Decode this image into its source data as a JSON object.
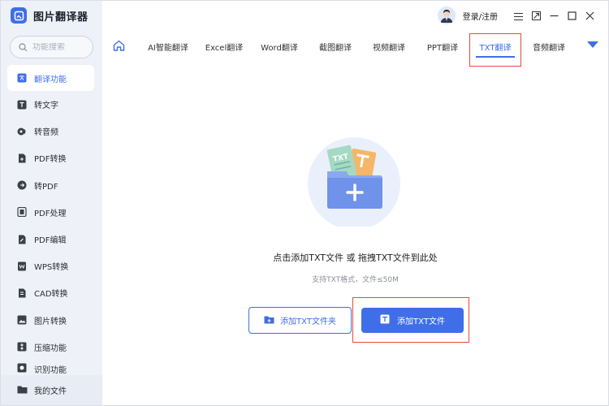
{
  "app": {
    "title": "图片翻译器"
  },
  "search": {
    "placeholder": "功能搜索"
  },
  "sidebar": {
    "items": [
      {
        "label": "翻译功能",
        "icon": "translate-icon"
      },
      {
        "label": "转文字",
        "icon": "text-icon"
      },
      {
        "label": "转音频",
        "icon": "audio-icon"
      },
      {
        "label": "PDF转换",
        "icon": "pdf-convert-icon"
      },
      {
        "label": "转PDF",
        "icon": "to-pdf-icon"
      },
      {
        "label": "PDF处理",
        "icon": "pdf-process-icon"
      },
      {
        "label": "PDF编辑",
        "icon": "pdf-edit-icon"
      },
      {
        "label": "WPS转换",
        "icon": "wps-icon"
      },
      {
        "label": "CAD转换",
        "icon": "cad-icon"
      },
      {
        "label": "图片转换",
        "icon": "image-icon"
      },
      {
        "label": "压缩功能",
        "icon": "compress-icon"
      },
      {
        "label": "识别功能",
        "icon": "recognize-icon"
      }
    ],
    "my_files": "我的文件"
  },
  "header": {
    "login": "登录/注册"
  },
  "tabs": [
    {
      "label": "AI智能翻译"
    },
    {
      "label": "Excel翻译"
    },
    {
      "label": "Word翻译"
    },
    {
      "label": "截图翻译"
    },
    {
      "label": "视频翻译"
    },
    {
      "label": "PPT翻译"
    },
    {
      "label": "TXT翻译"
    },
    {
      "label": "音频翻译"
    }
  ],
  "illustration": {
    "doc_label": "TXT"
  },
  "dropzone": {
    "prompt": "点击添加TXT文件 或 拖拽TXT文件到此处",
    "sub": "支持TXT格式，文件≤50M",
    "add_folder": "添加TXT文件夹",
    "add_file": "添加TXT文件"
  },
  "colors": {
    "accent": "#3f6ee8",
    "highlight": "#e34a3e",
    "sidebar_bg": "#eef2f8"
  }
}
